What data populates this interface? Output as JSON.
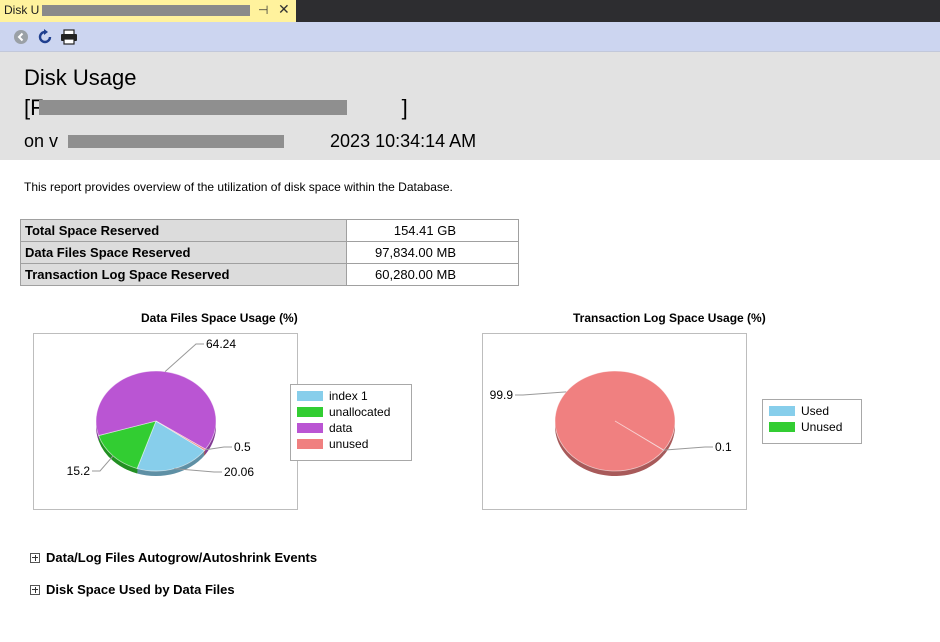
{
  "tab": {
    "title": "Disk U",
    "pin_glyph": "⊣",
    "close_glyph": "✕"
  },
  "toolbar": {
    "buttons": [
      {
        "name": "back-icon"
      },
      {
        "name": "refresh-icon"
      },
      {
        "name": "print-icon"
      }
    ]
  },
  "header": {
    "title": "Disk Usage",
    "db_open": "[F",
    "db_close": "]",
    "server_prefix": "on v",
    "server_suffix": "2023 10:34:14 AM"
  },
  "description": "This report provides overview of the utilization of disk space within the Database.",
  "summary": {
    "rows": [
      {
        "label": "Total Space Reserved",
        "value": "154.41 GB"
      },
      {
        "label": "Data Files Space Reserved",
        "value": "97,834.00 MB"
      },
      {
        "label": "Transaction Log Space Reserved",
        "value": "60,280.00 MB"
      }
    ]
  },
  "colors": {
    "index": "#87ceeb",
    "unallocated": "#32cd32",
    "data": "#ba55d3",
    "unused": "#f08080",
    "used": "#87ceeb"
  },
  "chart_data": [
    {
      "type": "pie",
      "title": "Data Files Space Usage (%)",
      "categories": [
        "index 1",
        "unallocated",
        "data",
        "unused"
      ],
      "values": [
        20.06,
        15.2,
        64.24,
        0.5
      ],
      "value_labels": [
        "20.06",
        "15.2",
        "64.24",
        "0.5"
      ],
      "legend": "right"
    },
    {
      "type": "pie",
      "title": "Transaction Log Space Usage (%)",
      "categories": [
        "Used",
        "Unused"
      ],
      "values": [
        0.1,
        99.9
      ],
      "value_labels": [
        "0.1",
        "99.9"
      ],
      "legend": "right"
    }
  ],
  "sections": [
    {
      "label": "Data/Log Files Autogrow/Autoshrink Events"
    },
    {
      "label": "Disk Space Used by Data Files"
    }
  ]
}
